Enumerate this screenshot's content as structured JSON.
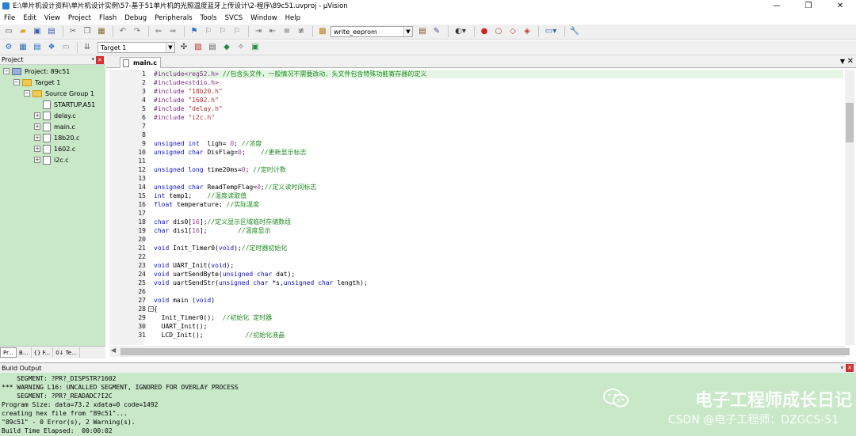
{
  "window": {
    "title": "E:\\单片机设计资料\\单片机设计实例\\57-基于51单片机的光照温度蓝牙上传设计\\2-程序\\89c51.uvproj - µVision",
    "controls": [
      "—",
      "❐",
      "✕"
    ]
  },
  "menu": [
    "File",
    "Edit",
    "View",
    "Project",
    "Flash",
    "Debug",
    "Peripherals",
    "Tools",
    "SVCS",
    "Window",
    "Help"
  ],
  "toolbar": {
    "find_combo": "write_eeprom",
    "target_combo": "Target 1"
  },
  "project_panel": {
    "title": "Project",
    "pin": "ᵠ",
    "tree": [
      {
        "label": "Project: 89c51",
        "indent": 0,
        "expander": "−",
        "kind": "project"
      },
      {
        "label": "Target 1",
        "indent": 1,
        "expander": "−",
        "kind": "folder"
      },
      {
        "label": "Source Group 1",
        "indent": 2,
        "expander": "−",
        "kind": "folder"
      },
      {
        "label": "STARTUP.A51",
        "indent": 3,
        "expander": "",
        "kind": "file"
      },
      {
        "label": "delay.c",
        "indent": 3,
        "expander": "+",
        "kind": "file"
      },
      {
        "label": "main.c",
        "indent": 3,
        "expander": "+",
        "kind": "file"
      },
      {
        "label": "18b20.c",
        "indent": 3,
        "expander": "+",
        "kind": "file"
      },
      {
        "label": "1602.c",
        "indent": 3,
        "expander": "+",
        "kind": "file"
      },
      {
        "label": "i2c.c",
        "indent": 3,
        "expander": "+",
        "kind": "file"
      }
    ],
    "tabs": [
      "Pr...",
      "B...",
      "{} F...",
      "0↓ Te..."
    ]
  },
  "editor": {
    "tab": "main.c",
    "lines": [
      {
        "n": "1",
        "segs": [
          [
            "pp",
            "#include<reg52.h>"
          ],
          [
            "cm",
            " //包含头文件，一般情况不需要改动，头文件包含特殊功能寄存器的定义"
          ]
        ],
        "hl": true
      },
      {
        "n": "2",
        "segs": [
          [
            "pp",
            "#include<stdio.h>"
          ]
        ]
      },
      {
        "n": "3",
        "segs": [
          [
            "pp",
            "#include "
          ],
          [
            "str",
            "\"18b20.h\""
          ]
        ]
      },
      {
        "n": "4",
        "segs": [
          [
            "pp",
            "#include "
          ],
          [
            "str",
            "\"1602.h\""
          ]
        ]
      },
      {
        "n": "5",
        "segs": [
          [
            "pp",
            "#include "
          ],
          [
            "str",
            "\"delay.h\""
          ]
        ]
      },
      {
        "n": "6",
        "segs": [
          [
            "pp",
            "#include "
          ],
          [
            "str",
            "\"i2c.h\""
          ]
        ]
      },
      {
        "n": "7",
        "segs": []
      },
      {
        "n": "8",
        "segs": []
      },
      {
        "n": "9",
        "segs": [
          [
            "kw",
            "unsigned int"
          ],
          [
            "",
            "  ligh= "
          ],
          [
            "num",
            "0"
          ],
          [
            "",
            "; "
          ],
          [
            "cm",
            "//浓度"
          ]
        ]
      },
      {
        "n": "10",
        "segs": [
          [
            "kw",
            "unsigned char"
          ],
          [
            "",
            " DisFlag="
          ],
          [
            "num",
            "0"
          ],
          [
            "",
            ";    "
          ],
          [
            "cm",
            "//更新显示标志"
          ]
        ]
      },
      {
        "n": "11",
        "segs": []
      },
      {
        "n": "12",
        "segs": [
          [
            "kw",
            "unsigned long"
          ],
          [
            "",
            " time20ms="
          ],
          [
            "num",
            "0"
          ],
          [
            "",
            "; "
          ],
          [
            "cm",
            "//定时计数"
          ]
        ]
      },
      {
        "n": "13",
        "segs": []
      },
      {
        "n": "14",
        "segs": [
          [
            "kw",
            "unsigned char"
          ],
          [
            "",
            " ReadTempFlag="
          ],
          [
            "num",
            "0"
          ],
          [
            "",
            ";"
          ],
          [
            "cm",
            "//定义读时间标志"
          ]
        ]
      },
      {
        "n": "15",
        "segs": [
          [
            "kw",
            "int"
          ],
          [
            "",
            " temp1;    "
          ],
          [
            "cm",
            "//温度读取值"
          ]
        ]
      },
      {
        "n": "16",
        "segs": [
          [
            "kw",
            "float"
          ],
          [
            "",
            " temperature; "
          ],
          [
            "cm",
            "//实际温度"
          ]
        ]
      },
      {
        "n": "17",
        "segs": []
      },
      {
        "n": "18",
        "segs": [
          [
            "kw",
            "char"
          ],
          [
            "",
            " dis0["
          ],
          [
            "num",
            "16"
          ],
          [
            "",
            "];"
          ],
          [
            "cm",
            "//定义显示区域临时存储数组"
          ]
        ]
      },
      {
        "n": "19",
        "segs": [
          [
            "kw",
            "char"
          ],
          [
            "",
            " dis1["
          ],
          [
            "num",
            "16"
          ],
          [
            "",
            "];        "
          ],
          [
            "cm",
            "//温度显示"
          ]
        ]
      },
      {
        "n": "20",
        "segs": []
      },
      {
        "n": "21",
        "segs": [
          [
            "kw",
            "void"
          ],
          [
            "",
            " Init_Timer0("
          ],
          [
            "kw",
            "void"
          ],
          [
            "",
            ");"
          ],
          [
            "cm",
            "//定时器初始化"
          ]
        ]
      },
      {
        "n": "22",
        "segs": []
      },
      {
        "n": "23",
        "segs": [
          [
            "kw",
            "void"
          ],
          [
            "",
            " UART_Init("
          ],
          [
            "kw",
            "void"
          ],
          [
            "",
            ");"
          ]
        ]
      },
      {
        "n": "24",
        "segs": [
          [
            "kw",
            "void"
          ],
          [
            "",
            " uartSendByte("
          ],
          [
            "kw",
            "unsigned char"
          ],
          [
            "",
            " dat);"
          ]
        ]
      },
      {
        "n": "25",
        "segs": [
          [
            "kw",
            "void"
          ],
          [
            "",
            " uartSendStr("
          ],
          [
            "kw",
            "unsigned char"
          ],
          [
            "",
            " *s,"
          ],
          [
            "kw",
            "unsigned char"
          ],
          [
            "",
            " length);"
          ]
        ]
      },
      {
        "n": "26",
        "segs": []
      },
      {
        "n": "27",
        "segs": [
          [
            "kw",
            "void"
          ],
          [
            "",
            " main ("
          ],
          [
            "kw",
            "void"
          ],
          [
            "",
            ")"
          ]
        ]
      },
      {
        "n": "28",
        "segs": [
          [
            "",
            "{"
          ]
        ],
        "fold": "−"
      },
      {
        "n": "29",
        "segs": [
          [
            "",
            "  Init_Timer0();  "
          ],
          [
            "cm",
            "//初始化 定时器"
          ]
        ]
      },
      {
        "n": "30",
        "segs": [
          [
            "",
            "  UART_Init();"
          ]
        ]
      },
      {
        "n": "31",
        "segs": [
          [
            "",
            "  LCD_Init();           "
          ],
          [
            "cm",
            "//初始化液晶"
          ]
        ]
      }
    ]
  },
  "build_output": {
    "title": "Build Output",
    "lines": [
      "    SEGMENT: ?PR?_DISPSTR?1602",
      "*** WARNING L16: UNCALLED SEGMENT, IGNORED FOR OVERLAY PROCESS",
      "    SEGMENT: ?PR?_READADC?I2C",
      "Program Size: data=73.2 xdata=0 code=1492",
      "creating hex file from \"89c51\"...",
      "\"89c51\" - 0 Error(s), 2 Warning(s).",
      "Build Time Elapsed:  00:00:02"
    ]
  },
  "watermark": {
    "line1": "电子工程师成长日记",
    "line2": "CSDN @电子工程师：DZGCS-51"
  },
  "colors": {
    "tree_bg": "#c8e8c8",
    "output_bg": "#c8e8c8",
    "keyword": "#1010c0",
    "comment": "#1e8a1e",
    "preprocessor": "#7f2a7f",
    "string": "#b03030"
  }
}
